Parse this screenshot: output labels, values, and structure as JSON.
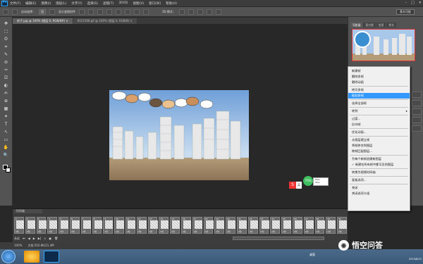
{
  "app": {
    "logo_text": "Ps"
  },
  "menubar": {
    "items": [
      "文件(F)",
      "编辑(E)",
      "图像(I)",
      "图层(L)",
      "文字(Y)",
      "选择(S)",
      "滤镜(T)",
      "3D(D)",
      "视图(V)",
      "窗口(W)",
      "帮助(H)"
    ],
    "window_controls": [
      "–",
      "□",
      "✕"
    ]
  },
  "options_bar": {
    "auto_select_label": "自动选择：",
    "auto_select_value": "组",
    "show_transform_label": "显示变换控件",
    "mode_3d_label": "3D 模式：",
    "workspace_label": "基本功能"
  },
  "tabs": [
    {
      "label": "房子.jpg @ 100% (图层 0, RGB/8#) ×",
      "active": true
    },
    {
      "label": "6011568.gif @ 100% (图层 0, RGB/8) ×",
      "active": false
    }
  ],
  "navigator": {
    "tabs": [
      "导航器",
      "直方图",
      "信息",
      "样式"
    ]
  },
  "context_menu": {
    "items": [
      {
        "label": "新建帧"
      },
      {
        "label": "删除多帧"
      },
      {
        "label": "删除动画"
      },
      {
        "sep": true
      },
      {
        "label": "拷贝多帧"
      },
      {
        "label": "粘贴多帧",
        "highlight": true
      },
      {
        "sep": true
      },
      {
        "label": "选择全部帧"
      },
      {
        "sep": true
      },
      {
        "label": "转到",
        "submenu": true
      },
      {
        "sep": true
      },
      {
        "label": "过渡..."
      },
      {
        "label": "反向帧"
      },
      {
        "sep": true
      },
      {
        "label": "优化动画..."
      },
      {
        "sep": true
      },
      {
        "label": "从图层建立帧"
      },
      {
        "label": "将帧拼合到图层"
      },
      {
        "label": "跨帧匹配图层..."
      },
      {
        "sep": true
      },
      {
        "label": "为每个新帧创建新图层"
      },
      {
        "label": "✓ 新建在所有帧中都可见的图层"
      },
      {
        "sep": true
      },
      {
        "label": "转换为视频时间轴"
      },
      {
        "sep": true
      },
      {
        "label": "面板选项..."
      },
      {
        "sep": true
      },
      {
        "label": "关闭"
      },
      {
        "label": "关闭选项卡组"
      }
    ]
  },
  "timeline": {
    "title": "时间轴",
    "frame_count": 30,
    "frame_delay": "0秒",
    "loop_label": "永远"
  },
  "status_bar": {
    "zoom": "100%",
    "doc_size": "文档:502.8K/21.4M"
  },
  "widget": {
    "percent": "70%",
    "speed_up": "0K/s",
    "speed_down": "0K/s"
  },
  "taskbar": {
    "clock_time": "",
    "clock_date": "2015/8/15",
    "desktop_label": "桌面"
  },
  "watermark": {
    "text": "悟空问答"
  },
  "colors": {
    "accent": "#3399ff",
    "ps_blue": "#31a8ff",
    "panel": "#535353",
    "canvas": "#282828"
  }
}
